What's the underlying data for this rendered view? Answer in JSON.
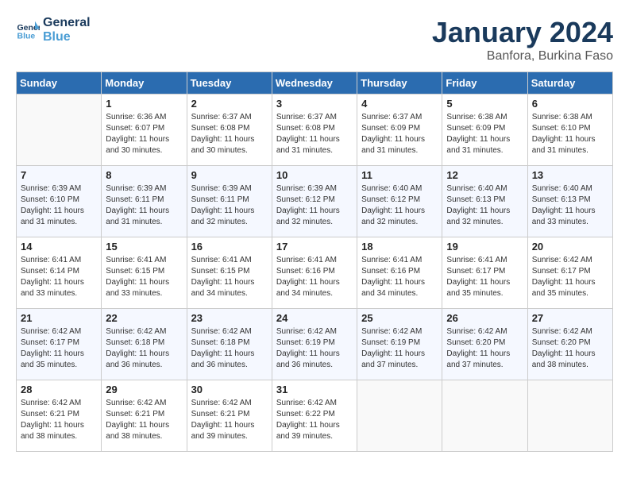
{
  "logo": {
    "line1": "General",
    "line2": "Blue"
  },
  "title": "January 2024",
  "subtitle": "Banfora, Burkina Faso",
  "weekdays": [
    "Sunday",
    "Monday",
    "Tuesday",
    "Wednesday",
    "Thursday",
    "Friday",
    "Saturday"
  ],
  "weeks": [
    [
      {
        "day": "",
        "info": ""
      },
      {
        "day": "1",
        "info": "Sunrise: 6:36 AM\nSunset: 6:07 PM\nDaylight: 11 hours\nand 30 minutes."
      },
      {
        "day": "2",
        "info": "Sunrise: 6:37 AM\nSunset: 6:08 PM\nDaylight: 11 hours\nand 30 minutes."
      },
      {
        "day": "3",
        "info": "Sunrise: 6:37 AM\nSunset: 6:08 PM\nDaylight: 11 hours\nand 31 minutes."
      },
      {
        "day": "4",
        "info": "Sunrise: 6:37 AM\nSunset: 6:09 PM\nDaylight: 11 hours\nand 31 minutes."
      },
      {
        "day": "5",
        "info": "Sunrise: 6:38 AM\nSunset: 6:09 PM\nDaylight: 11 hours\nand 31 minutes."
      },
      {
        "day": "6",
        "info": "Sunrise: 6:38 AM\nSunset: 6:10 PM\nDaylight: 11 hours\nand 31 minutes."
      }
    ],
    [
      {
        "day": "7",
        "info": "Sunrise: 6:39 AM\nSunset: 6:10 PM\nDaylight: 11 hours\nand 31 minutes."
      },
      {
        "day": "8",
        "info": "Sunrise: 6:39 AM\nSunset: 6:11 PM\nDaylight: 11 hours\nand 31 minutes."
      },
      {
        "day": "9",
        "info": "Sunrise: 6:39 AM\nSunset: 6:11 PM\nDaylight: 11 hours\nand 32 minutes."
      },
      {
        "day": "10",
        "info": "Sunrise: 6:39 AM\nSunset: 6:12 PM\nDaylight: 11 hours\nand 32 minutes."
      },
      {
        "day": "11",
        "info": "Sunrise: 6:40 AM\nSunset: 6:12 PM\nDaylight: 11 hours\nand 32 minutes."
      },
      {
        "day": "12",
        "info": "Sunrise: 6:40 AM\nSunset: 6:13 PM\nDaylight: 11 hours\nand 32 minutes."
      },
      {
        "day": "13",
        "info": "Sunrise: 6:40 AM\nSunset: 6:13 PM\nDaylight: 11 hours\nand 33 minutes."
      }
    ],
    [
      {
        "day": "14",
        "info": "Sunrise: 6:41 AM\nSunset: 6:14 PM\nDaylight: 11 hours\nand 33 minutes."
      },
      {
        "day": "15",
        "info": "Sunrise: 6:41 AM\nSunset: 6:15 PM\nDaylight: 11 hours\nand 33 minutes."
      },
      {
        "day": "16",
        "info": "Sunrise: 6:41 AM\nSunset: 6:15 PM\nDaylight: 11 hours\nand 34 minutes."
      },
      {
        "day": "17",
        "info": "Sunrise: 6:41 AM\nSunset: 6:16 PM\nDaylight: 11 hours\nand 34 minutes."
      },
      {
        "day": "18",
        "info": "Sunrise: 6:41 AM\nSunset: 6:16 PM\nDaylight: 11 hours\nand 34 minutes."
      },
      {
        "day": "19",
        "info": "Sunrise: 6:41 AM\nSunset: 6:17 PM\nDaylight: 11 hours\nand 35 minutes."
      },
      {
        "day": "20",
        "info": "Sunrise: 6:42 AM\nSunset: 6:17 PM\nDaylight: 11 hours\nand 35 minutes."
      }
    ],
    [
      {
        "day": "21",
        "info": "Sunrise: 6:42 AM\nSunset: 6:17 PM\nDaylight: 11 hours\nand 35 minutes."
      },
      {
        "day": "22",
        "info": "Sunrise: 6:42 AM\nSunset: 6:18 PM\nDaylight: 11 hours\nand 36 minutes."
      },
      {
        "day": "23",
        "info": "Sunrise: 6:42 AM\nSunset: 6:18 PM\nDaylight: 11 hours\nand 36 minutes."
      },
      {
        "day": "24",
        "info": "Sunrise: 6:42 AM\nSunset: 6:19 PM\nDaylight: 11 hours\nand 36 minutes."
      },
      {
        "day": "25",
        "info": "Sunrise: 6:42 AM\nSunset: 6:19 PM\nDaylight: 11 hours\nand 37 minutes."
      },
      {
        "day": "26",
        "info": "Sunrise: 6:42 AM\nSunset: 6:20 PM\nDaylight: 11 hours\nand 37 minutes."
      },
      {
        "day": "27",
        "info": "Sunrise: 6:42 AM\nSunset: 6:20 PM\nDaylight: 11 hours\nand 38 minutes."
      }
    ],
    [
      {
        "day": "28",
        "info": "Sunrise: 6:42 AM\nSunset: 6:21 PM\nDaylight: 11 hours\nand 38 minutes."
      },
      {
        "day": "29",
        "info": "Sunrise: 6:42 AM\nSunset: 6:21 PM\nDaylight: 11 hours\nand 38 minutes."
      },
      {
        "day": "30",
        "info": "Sunrise: 6:42 AM\nSunset: 6:21 PM\nDaylight: 11 hours\nand 39 minutes."
      },
      {
        "day": "31",
        "info": "Sunrise: 6:42 AM\nSunset: 6:22 PM\nDaylight: 11 hours\nand 39 minutes."
      },
      {
        "day": "",
        "info": ""
      },
      {
        "day": "",
        "info": ""
      },
      {
        "day": "",
        "info": ""
      }
    ]
  ]
}
